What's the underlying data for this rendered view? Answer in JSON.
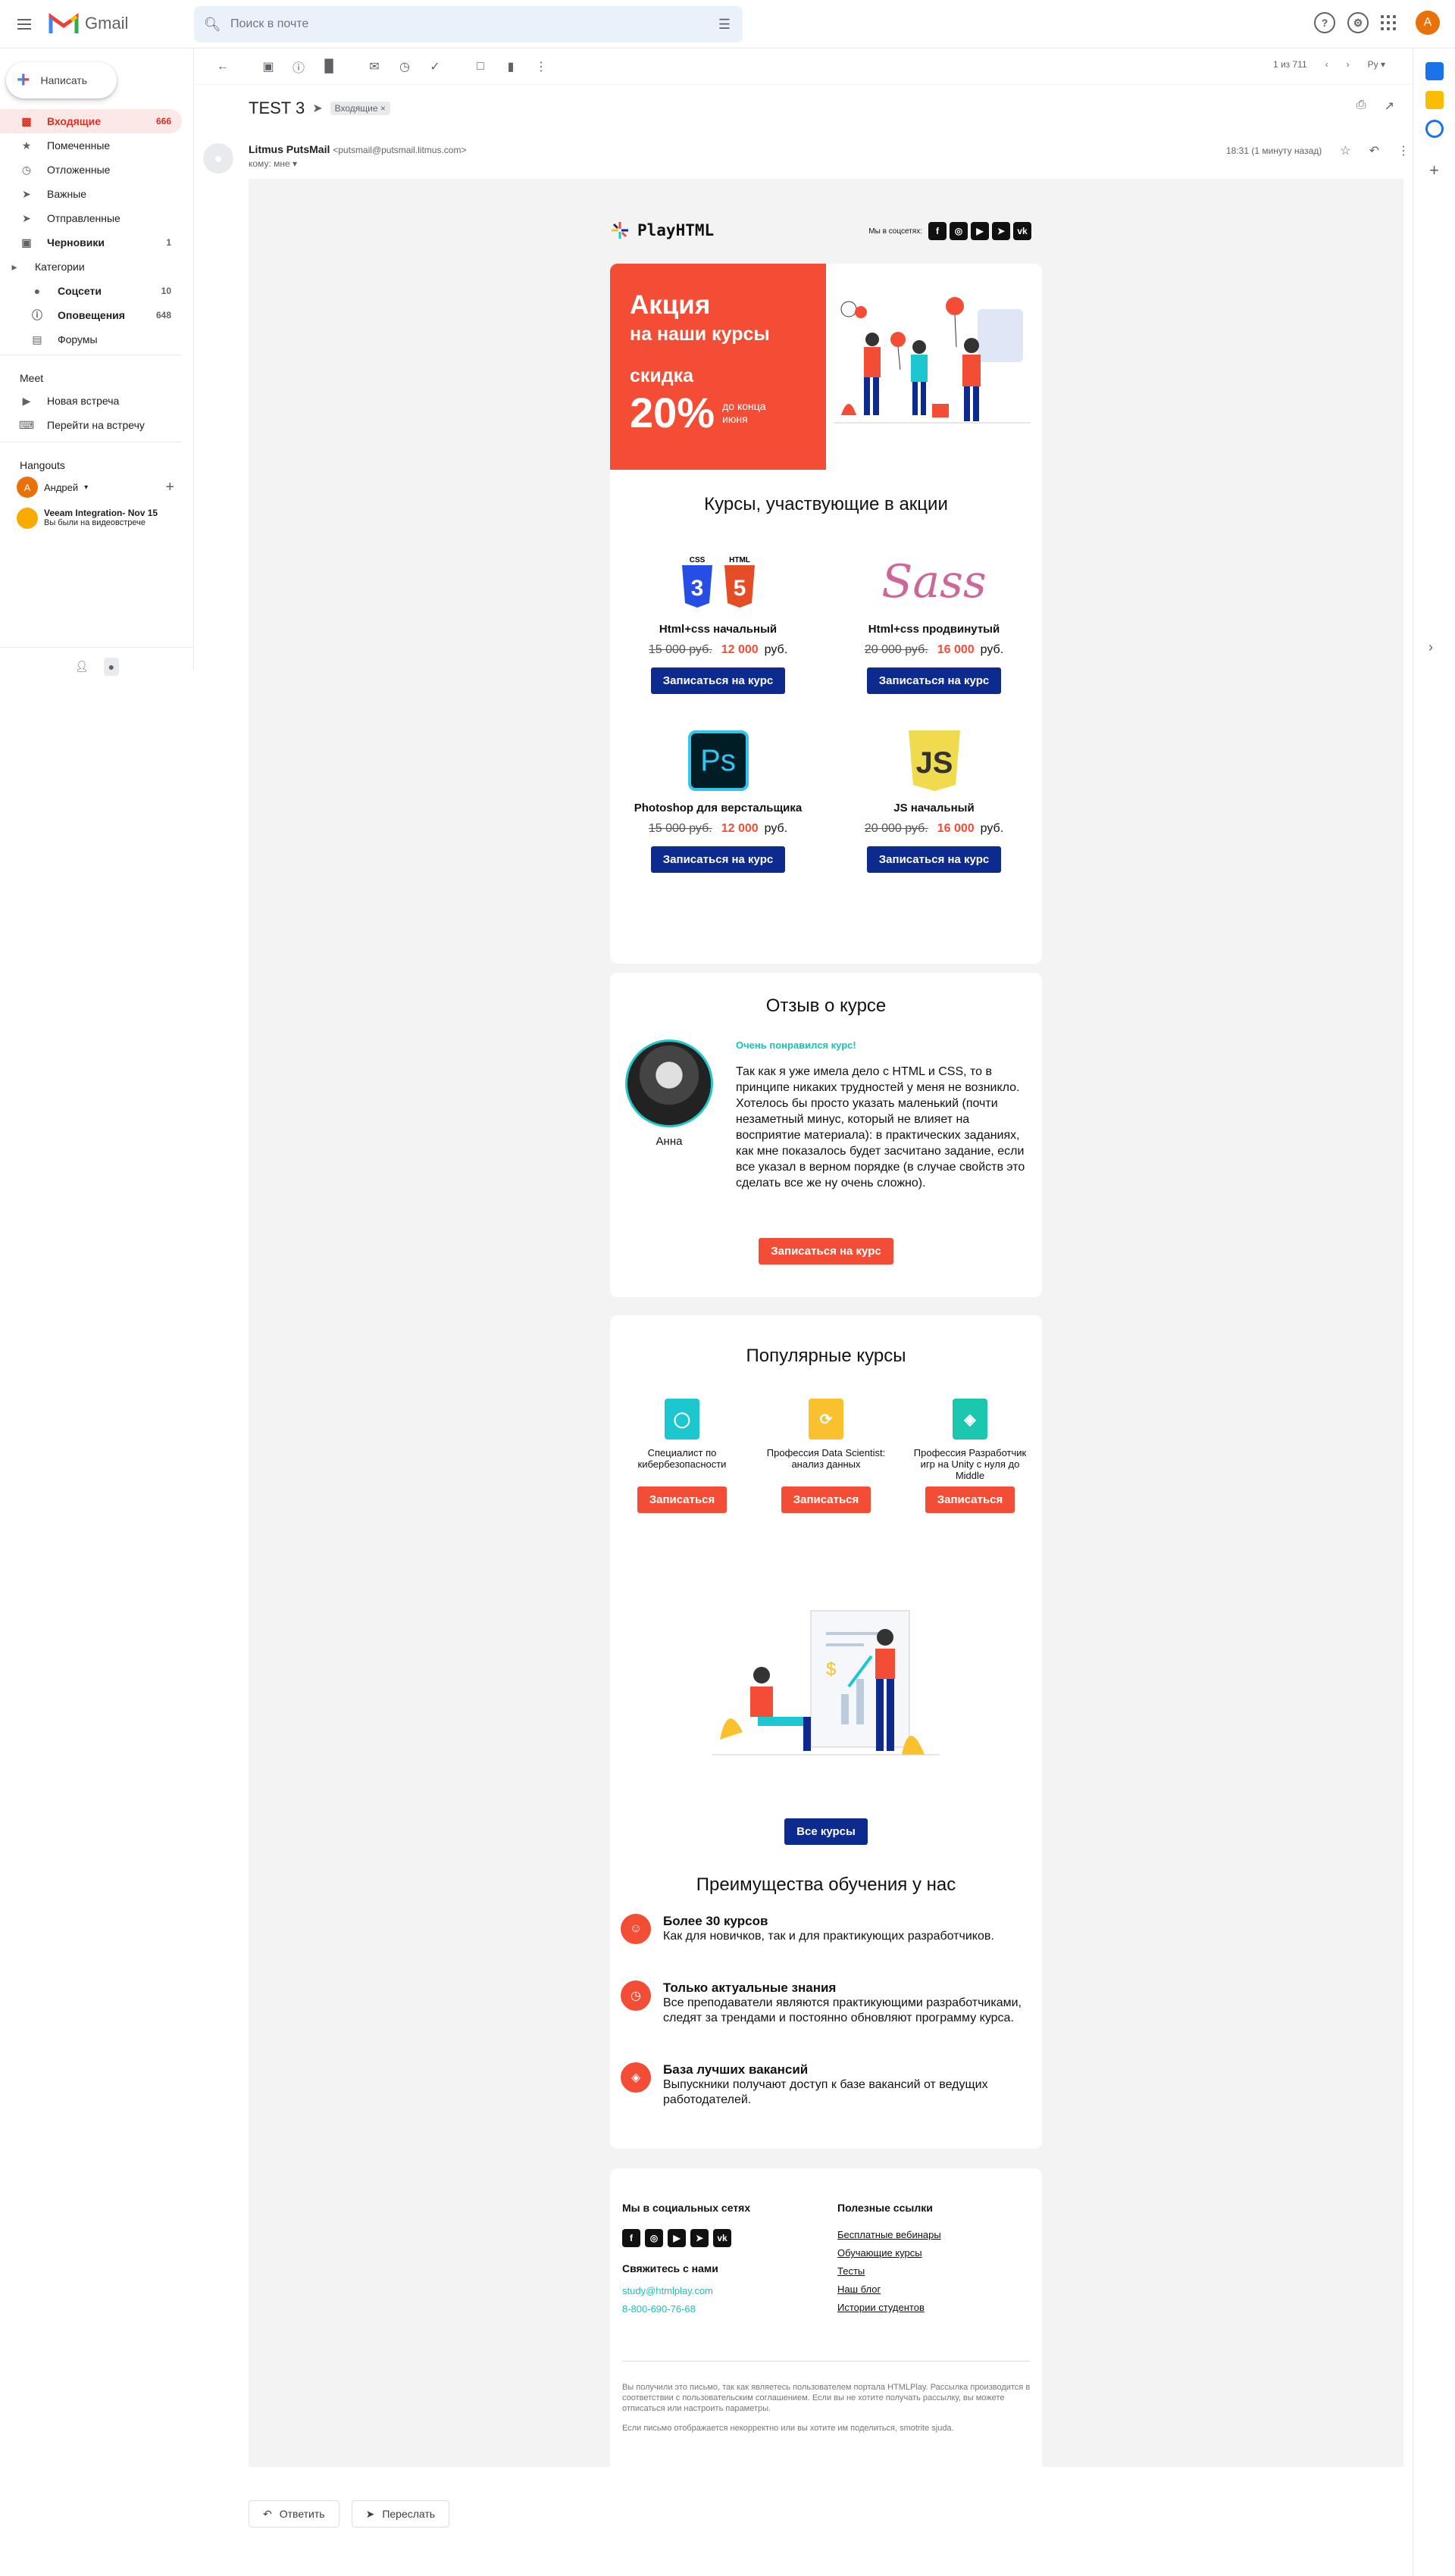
{
  "gmail": {
    "logo": "Gmail",
    "search_placeholder": "Поиск в почте",
    "avatar": "A",
    "compose": "Написать",
    "folders": [
      {
        "label": "Входящие",
        "count": "666",
        "icon": "inbox-icon"
      },
      {
        "label": "Помеченные",
        "count": "",
        "icon": "star-icon"
      },
      {
        "label": "Отложенные",
        "count": "",
        "icon": "clock-icon"
      },
      {
        "label": "Важные",
        "count": "",
        "icon": "label-important-icon"
      },
      {
        "label": "Отправленные",
        "count": "",
        "icon": "send-icon"
      },
      {
        "label": "Черновики",
        "count": "1",
        "icon": "draft-icon"
      },
      {
        "label": "Категории",
        "count": "",
        "icon": "label-icon"
      },
      {
        "label": "Соцсети",
        "count": "10",
        "icon": "people-icon"
      },
      {
        "label": "Оповещения",
        "count": "648",
        "icon": "info-icon"
      },
      {
        "label": "Форумы",
        "count": "",
        "icon": "forum-icon"
      }
    ],
    "meet": {
      "title": "Meet",
      "new": "Новая встреча",
      "join": "Перейти на встречу"
    },
    "hangouts": {
      "title": "Hangouts",
      "user": "Андрей",
      "user_av": "A",
      "conv_name": "Veeam Integration- Nov 15",
      "conv_sub": "Вы были на видеовстрече"
    },
    "pager": "1 из 711",
    "lang": "Ру",
    "subject": "TEST 3",
    "label": "Входящие",
    "sender": {
      "name": "Litmus PutsMail",
      "email": "<putsmail@putsmail.litmus.com>",
      "to": "кому: мне",
      "time": "18:31 (1 минуту назад)"
    },
    "reply": "Ответить",
    "forward": "Переслать"
  },
  "email": {
    "brand": "PlayHTML",
    "social_label": "Мы в соцсетях:",
    "social": [
      "f",
      "◎",
      "▶",
      "➤",
      "vk"
    ],
    "promo": {
      "line1": "Акция",
      "line2": "на наши курсы",
      "line3": "скидка",
      "pct": "20%",
      "until": "до конца июня"
    },
    "courses_title": "Курсы, участвующие в акции",
    "courses": [
      {
        "name": "Html+css начальный",
        "old": "15 000 руб.",
        "new": "12 000",
        "cur": "руб.",
        "btn": "Записаться на курс"
      },
      {
        "name": "Html+css продвинутый",
        "old": "20 000 руб.",
        "new": "16 000",
        "cur": "руб.",
        "btn": "Записаться на курс"
      },
      {
        "name": "Photoshop для верстальщика",
        "old": "15 000 руб.",
        "new": "12 000",
        "cur": "руб.",
        "btn": "Записаться на курс"
      },
      {
        "name": "JS начальный",
        "old": "20 000 руб.",
        "new": "16 000",
        "cur": "руб.",
        "btn": "Записаться на курс"
      }
    ],
    "icons": {
      "css": "CSS",
      "html": "HTML",
      "sass": "Sass",
      "ps": "Ps",
      "js": "JS"
    },
    "review": {
      "title": "Отзыв о курсе",
      "headline": "Очень понравился курс!",
      "text": "Так как я уже имела дело с HTML и CSS, то в принципе никаких трудностей у меня не возникло. Хотелось бы просто указать маленький (почти незаметный минус, который не влияет на восприятие материала): в практических заданиях, как мне показалось будет засчитано задание, если все указал в верном порядке (в случае свойств это сделать все же ну очень сложно).",
      "name": "Анна",
      "btn": "Записаться на курс"
    },
    "popular": {
      "title": "Популярные курсы",
      "items": [
        {
          "name": "Специалист по кибербезопасности",
          "btn": "Записаться",
          "color": "#1cc7d0"
        },
        {
          "name": "Профессия Data Scientist: анализ данных",
          "btn": "Записаться",
          "color": "#fbc02d"
        },
        {
          "name": "Профессия Разработчик игр на Unity с нуля до Middle",
          "btn": "Записаться",
          "color": "#1cc7b0"
        }
      ],
      "all_btn": "Все курсы"
    },
    "advantages": {
      "title": "Преимущества обучения у нас",
      "items": [
        {
          "h": "Более 30 курсов",
          "t": "Как для новичков, так и для практикующих разработчиков."
        },
        {
          "h": "Только актуальные знания",
          "t": "Все преподаватели являются практикующими разработчиками, следят за трендами и постоянно обновляют программу курса."
        },
        {
          "h": "База лучших вакансий",
          "t": "Выпускники получают доступ к базе вакансий от ведущих работодателей."
        }
      ]
    },
    "footer": {
      "social_title": "Мы в социальных сетях",
      "contact_title": "Свяжитесь с нами",
      "email": "study@htmlplay.com",
      "phone": "8-800-690-76-68",
      "links_title": "Полезные ссылки",
      "links": [
        "Бесплатные вебинары",
        "Обучающие курсы",
        "Тесты",
        "Наш блог",
        "Истории студентов"
      ],
      "note1": "Вы получили это письмо, так как являетесь пользователем портала HTMLPlay. Рассылка производится в соответствии с пользовательским соглашением. Если вы не хотите получать рассылку, вы можете отписаться или настроить параметры.",
      "note2": "Если письмо отображается некорректно или вы хотите им поделиться, smotrite sjuda."
    }
  },
  "colors": {
    "accent": "#f44d35",
    "blue": "#0d2a8f",
    "teal": "#13c4b8",
    "gmail_red": "#d93025"
  }
}
